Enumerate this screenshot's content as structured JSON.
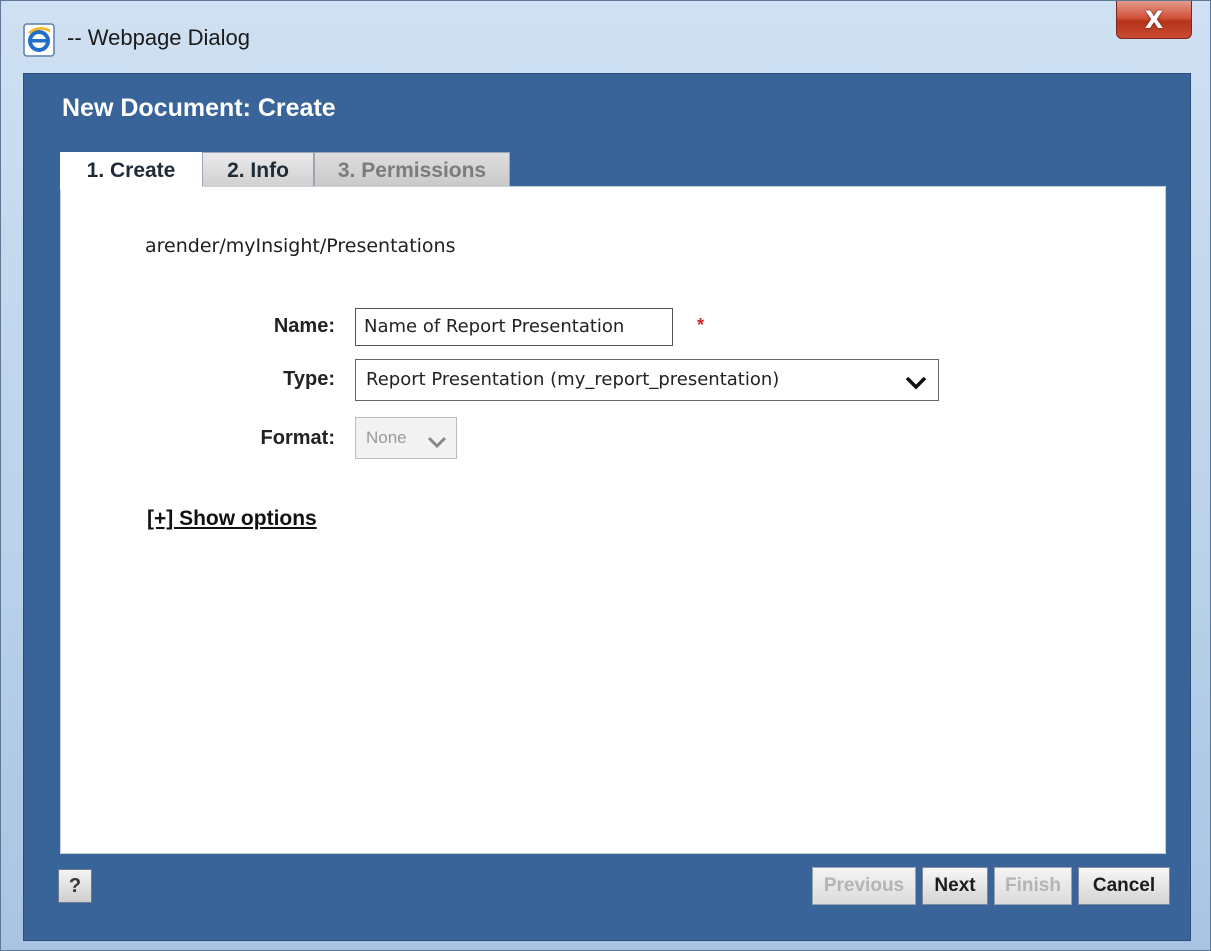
{
  "window": {
    "title": "-- Webpage Dialog",
    "close_label": "X"
  },
  "dialog": {
    "title": "New Document: Create",
    "tabs": [
      {
        "label": "1. Create",
        "state": "active"
      },
      {
        "label": "2. Info",
        "state": "inactive"
      },
      {
        "label": "3. Permissions",
        "state": "disabled"
      }
    ],
    "path": "arender/myInsight/Presentations",
    "form": {
      "name_label": "Name:",
      "name_value": "Name of Report Presentation",
      "required_mark": "*",
      "type_label": "Type:",
      "type_value": "Report Presentation (my_report_presentation)",
      "format_label": "Format:",
      "format_value": "None"
    },
    "show_options": "[+] Show options",
    "footer": {
      "help_label": "?",
      "previous_label": "Previous",
      "next_label": "Next",
      "finish_label": "Finish",
      "cancel_label": "Cancel"
    }
  },
  "colors": {
    "dialog_bg": "#38649a",
    "required": "#d32020",
    "close_button": "#c94a33"
  }
}
